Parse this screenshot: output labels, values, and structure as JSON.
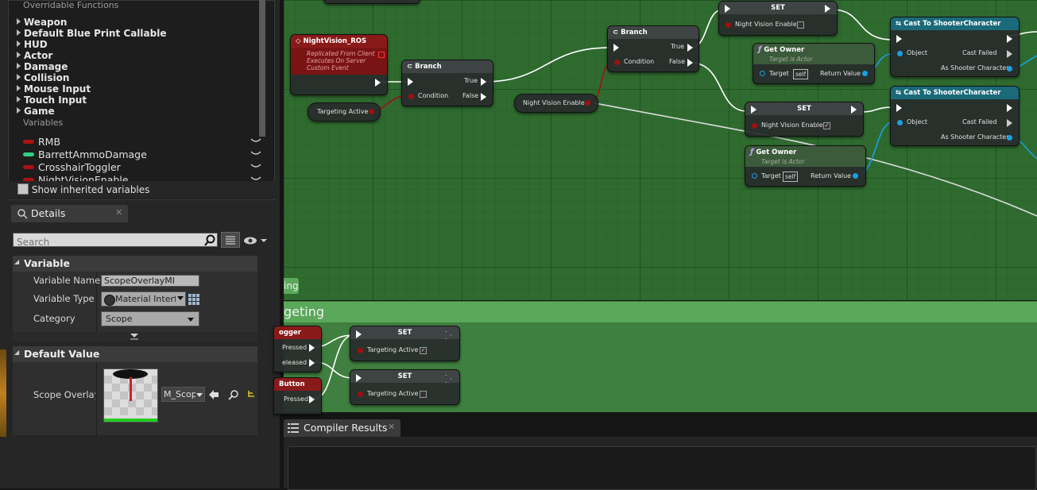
{
  "my_blueprint": {
    "overridable_label": "Overridable Functions",
    "categories": [
      "Weapon",
      "Default Blue Print Callable",
      "HUD",
      "Actor",
      "Damage",
      "Collision",
      "Mouse Input",
      "Touch Input",
      "Game"
    ],
    "variables_label": "Variables",
    "variables": [
      {
        "name": "RMB",
        "color": "#b01010"
      },
      {
        "name": "BarrettAmmoDamage",
        "color": "#30d080"
      },
      {
        "name": "CrosshairToggler",
        "color": "#b01010"
      },
      {
        "name": "NightVisionEnable",
        "color": "#b01010"
      }
    ],
    "show_inherited": "Show inherited variables"
  },
  "details": {
    "tab_label": "Details",
    "search_placeholder": "Search",
    "variable_section": "Variable",
    "variable_name_label": "Variable Name",
    "variable_name_value": "ScopeOverlayMI",
    "variable_type_label": "Variable Type",
    "variable_type_value": "Material Interfa",
    "category_label": "Category",
    "category_value": "Scope",
    "default_section": "Default Value",
    "scope_overlay_label": "Scope Overlay M",
    "asset_value": "M_Scop"
  },
  "graph": {
    "comment1_tail": "ing",
    "comment2_title": "geting",
    "nodes": {
      "nv_ros": {
        "title": "NightVision_ROS",
        "sub1": "Replicated From Client",
        "sub2": "Executes On Server",
        "sub3": "Custom Event"
      },
      "targeting_active_get": "Targeting Active",
      "branch1": {
        "title": "Branch",
        "true": "True",
        "false": "False",
        "condition": "Condition"
      },
      "nv_enable_get": "Night Vision Enable",
      "branch2": {
        "title": "Branch",
        "true": "True",
        "false": "False",
        "condition": "Condition"
      },
      "set1": {
        "title": "SET",
        "pin": "Night Vision Enable"
      },
      "set2": {
        "title": "SET",
        "pin": "Night Vision Enable"
      },
      "get_owner1": {
        "title": "Get Owner",
        "sub": "Target is Actor",
        "target": "Target",
        "self": "self",
        "ret": "Return Value"
      },
      "get_owner2": {
        "title": "Get Owner",
        "sub": "Target is Actor",
        "target": "Target",
        "self": "self",
        "ret": "Return Value"
      },
      "cast1": {
        "title": "Cast To ShooterCharacter",
        "object": "Object",
        "failed": "Cast Failed",
        "as": "As Shooter Character"
      },
      "cast2": {
        "title": "Cast To ShooterCharacter",
        "object": "Object",
        "failed": "Cast Failed",
        "as": "As Shooter Character"
      },
      "toggler": {
        "title": "ogger",
        "pressed": "Pressed",
        "released": "eleased"
      },
      "button": {
        "title": "Button",
        "pressed": "Pressed"
      },
      "set3": {
        "title": "SET",
        "pin": "Targeting Active"
      },
      "set4": {
        "title": "SET",
        "pin": "Targeting Active"
      }
    }
  },
  "compiler": {
    "tab_label": "Compiler Results"
  },
  "colors": {
    "graph_bg": "#2f6b2f",
    "exec": "#ffffff",
    "bool": "#a01010",
    "object": "#1aa0e0"
  }
}
